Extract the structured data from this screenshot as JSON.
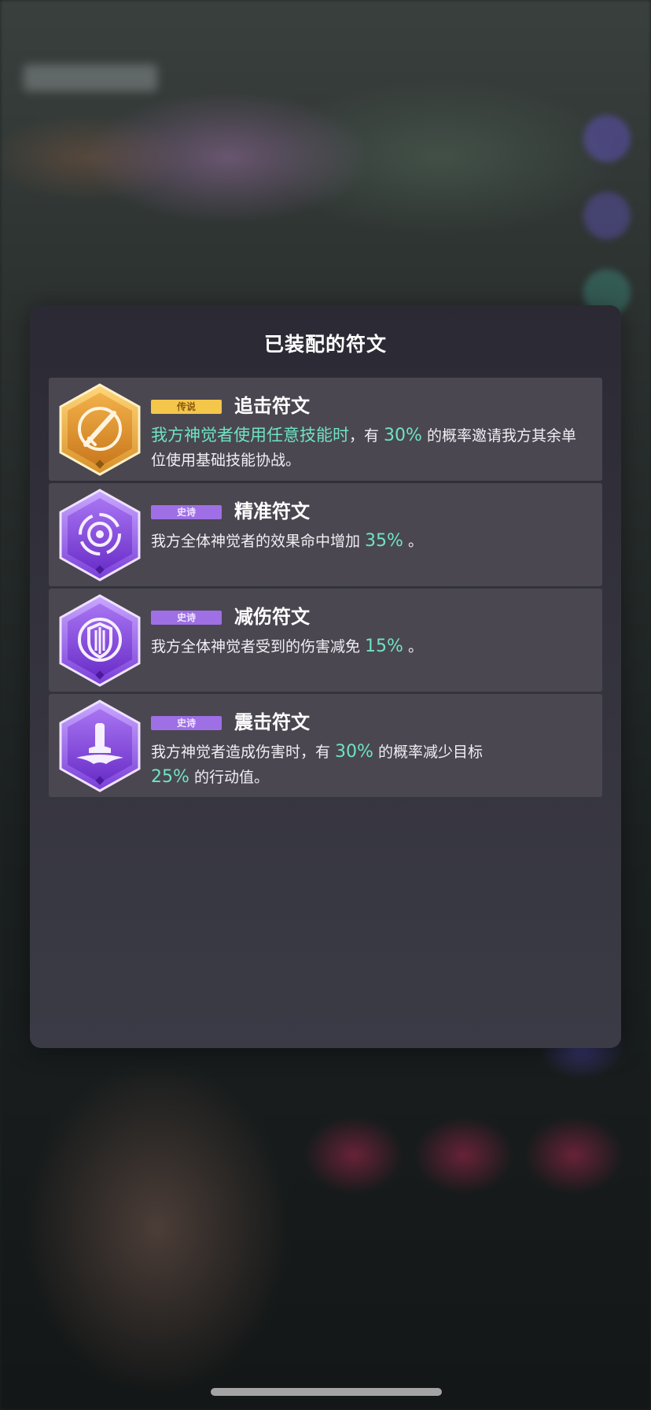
{
  "panel": {
    "title": "已装配的符文"
  },
  "runes": [
    {
      "rarity": "传说",
      "rarity_type": "legend",
      "name": "追击符文",
      "icon": "slash-strike-icon",
      "desc": {
        "lead": "我方神觉者使用任意技能时",
        "p1": "，有 ",
        "v1": "30%",
        "p2": " 的概率邀请我方其余单位使用基础技能协战。"
      }
    },
    {
      "rarity": "史诗",
      "rarity_type": "epic",
      "name": "精准符文",
      "icon": "target-icon",
      "desc": {
        "p1": "我方全体神觉者的效果命中增加 ",
        "v1": "35%",
        "p2": " 。"
      }
    },
    {
      "rarity": "史诗",
      "rarity_type": "epic",
      "name": "减伤符文",
      "icon": "shield-icon",
      "desc": {
        "p1": "我方全体神觉者受到的伤害减免 ",
        "v1": "15%",
        "p2": " 。"
      }
    },
    {
      "rarity": "史诗",
      "rarity_type": "epic",
      "name": "震击符文",
      "icon": "ground-slam-icon",
      "desc": {
        "p1": "我方神觉者造成伤害时，有 ",
        "v1": "30%",
        "p2": " 的概率减少目标",
        "v2": "25%",
        "p3": " 的行动值。"
      }
    }
  ],
  "colors": {
    "legend_badge": "#f4c64a",
    "epic_badge": "#9f6fe6",
    "highlight": "#6fe3c6",
    "panel_bg": "#33323c",
    "card_bg": "#4a4750"
  }
}
